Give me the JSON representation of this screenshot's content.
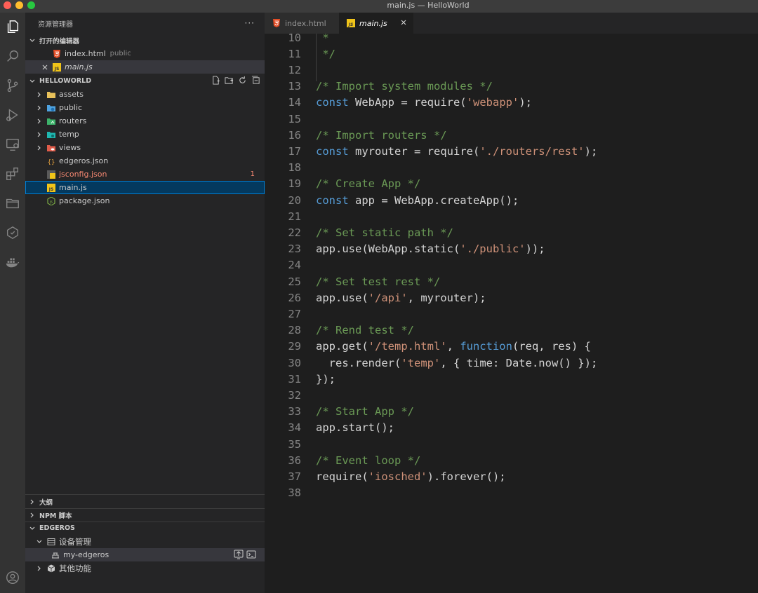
{
  "window": {
    "title": "main.js — HelloWorld"
  },
  "sidebar": {
    "header": "资源管理器",
    "more": "···",
    "open_editors": {
      "title": "打开的编辑器",
      "items": [
        {
          "name": "index.html",
          "hint": "public"
        },
        {
          "name": "main.js",
          "hint": ""
        }
      ]
    },
    "project": {
      "title": "HELLOWORLD",
      "items": [
        {
          "name": "assets",
          "type": "folder",
          "icon": "folder-icon",
          "color": "#e8c15a"
        },
        {
          "name": "public",
          "type": "folder",
          "icon": "folder-public-icon",
          "color": "#4fa3e0"
        },
        {
          "name": "routers",
          "type": "folder",
          "icon": "folder-routers-icon",
          "color": "#3db36b"
        },
        {
          "name": "temp",
          "type": "folder",
          "icon": "folder-temp-icon",
          "color": "#1fb7b0"
        },
        {
          "name": "views",
          "type": "folder",
          "icon": "folder-views-icon",
          "color": "#e05c4a"
        },
        {
          "name": "edgeros.json",
          "type": "file",
          "icon": "json-icon"
        },
        {
          "name": "jsconfig.json",
          "type": "file",
          "icon": "jsconfig-icon",
          "errors": "1"
        },
        {
          "name": "main.js",
          "type": "file",
          "icon": "js-icon"
        },
        {
          "name": "package.json",
          "type": "file",
          "icon": "npm-icon"
        }
      ]
    },
    "outline": "大纲",
    "npm_scripts": "NPM 脚本",
    "edgeros": {
      "title": "EDGEROS",
      "device_group": "设备管理",
      "device": "my-edgeros",
      "other": "其他功能"
    }
  },
  "tabs": [
    {
      "label": "index.html",
      "icon": "html-icon"
    },
    {
      "label": "main.js",
      "icon": "js-icon",
      "active": true
    }
  ],
  "editor": {
    "lines": [
      {
        "n": "10",
        "tokens": [
          [
            "cm",
            " *"
          ]
        ]
      },
      {
        "n": "11",
        "tokens": [
          [
            "cm",
            " */"
          ]
        ]
      },
      {
        "n": "12",
        "tokens": []
      },
      {
        "n": "13",
        "tokens": [
          [
            "cm",
            "/* Import system modules */"
          ]
        ]
      },
      {
        "n": "14",
        "tokens": [
          [
            "kw",
            "const"
          ],
          [
            "p",
            " WebApp = require("
          ],
          [
            "str",
            "'webapp'"
          ],
          [
            "p",
            ");"
          ]
        ]
      },
      {
        "n": "15",
        "tokens": []
      },
      {
        "n": "16",
        "tokens": [
          [
            "cm",
            "/* Import routers */"
          ]
        ]
      },
      {
        "n": "17",
        "tokens": [
          [
            "kw",
            "const"
          ],
          [
            "p",
            " myrouter = require("
          ],
          [
            "str",
            "'./routers/rest'"
          ],
          [
            "p",
            ");"
          ]
        ]
      },
      {
        "n": "18",
        "tokens": []
      },
      {
        "n": "19",
        "tokens": [
          [
            "cm",
            "/* Create App */"
          ]
        ]
      },
      {
        "n": "20",
        "tokens": [
          [
            "kw",
            "const"
          ],
          [
            "p",
            " app = WebApp.createApp();"
          ]
        ]
      },
      {
        "n": "21",
        "tokens": []
      },
      {
        "n": "22",
        "tokens": [
          [
            "cm",
            "/* Set static path */"
          ]
        ]
      },
      {
        "n": "23",
        "tokens": [
          [
            "p",
            "app.use(WebApp.static("
          ],
          [
            "str",
            "'./public'"
          ],
          [
            "p",
            "));"
          ]
        ]
      },
      {
        "n": "24",
        "tokens": []
      },
      {
        "n": "25",
        "tokens": [
          [
            "cm",
            "/* Set test rest */"
          ]
        ]
      },
      {
        "n": "26",
        "tokens": [
          [
            "p",
            "app.use("
          ],
          [
            "str",
            "'/api'"
          ],
          [
            "p",
            ", myrouter);"
          ]
        ]
      },
      {
        "n": "27",
        "tokens": []
      },
      {
        "n": "28",
        "tokens": [
          [
            "cm",
            "/* Rend test */"
          ]
        ]
      },
      {
        "n": "29",
        "tokens": [
          [
            "p",
            "app.get("
          ],
          [
            "str",
            "'/temp.html'"
          ],
          [
            "p",
            ", "
          ],
          [
            "kw",
            "function"
          ],
          [
            "p",
            "(req, res) {"
          ]
        ]
      },
      {
        "n": "30",
        "tokens": [
          [
            "p",
            "  res.render("
          ],
          [
            "str",
            "'temp'"
          ],
          [
            "p",
            ", { time: Date.now() });"
          ]
        ]
      },
      {
        "n": "31",
        "tokens": [
          [
            "p",
            "});"
          ]
        ]
      },
      {
        "n": "32",
        "tokens": []
      },
      {
        "n": "33",
        "tokens": [
          [
            "cm",
            "/* Start App */"
          ]
        ]
      },
      {
        "n": "34",
        "tokens": [
          [
            "p",
            "app.start();"
          ]
        ]
      },
      {
        "n": "35",
        "tokens": []
      },
      {
        "n": "36",
        "tokens": [
          [
            "cm",
            "/* Event loop */"
          ]
        ]
      },
      {
        "n": "37",
        "tokens": [
          [
            "p",
            "require("
          ],
          [
            "str",
            "'iosched'"
          ],
          [
            "p",
            ").forever();"
          ]
        ]
      },
      {
        "n": "38",
        "tokens": []
      }
    ]
  },
  "colors": {
    "comment": "#6a9955",
    "keyword": "#569cd6",
    "string": "#ce9178",
    "plain": "#d4d4d4",
    "selection": "#04395e",
    "error": "#f48771"
  }
}
